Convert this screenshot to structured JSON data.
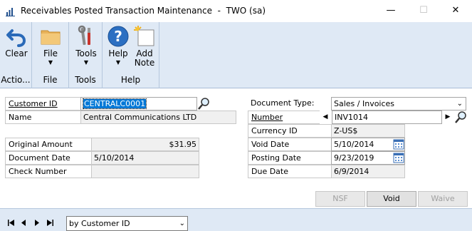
{
  "window": {
    "title": "Receivables Posted Transaction Maintenance  -  TWO (sa)",
    "minimize_glyph": "—",
    "maximize_glyph": "☐",
    "close_glyph": "✕"
  },
  "ribbon": {
    "groups": [
      {
        "label": "Actio...",
        "buttons": [
          {
            "label": "Clear",
            "icon": "undo-icon"
          }
        ]
      },
      {
        "label": "File",
        "buttons": [
          {
            "label": "File",
            "icon": "folder-icon",
            "dropdown": true
          }
        ]
      },
      {
        "label": "Tools",
        "buttons": [
          {
            "label": "Tools",
            "icon": "tools-icon",
            "dropdown": true
          }
        ]
      },
      {
        "label": "Help",
        "buttons": [
          {
            "label": "Help",
            "icon": "help-icon",
            "dropdown": true
          },
          {
            "label": "Add",
            "label2": "Note",
            "icon": "add-note-icon"
          }
        ]
      }
    ],
    "dropdown_glyph": "▼"
  },
  "form": {
    "customer_id": {
      "label": "Customer ID",
      "value": "CENTRALC0001"
    },
    "name": {
      "label": "Name",
      "value": "Central Communications LTD"
    },
    "original_amount": {
      "label": "Original Amount",
      "value": "$31.95"
    },
    "document_date": {
      "label": "Document Date",
      "value": "5/10/2014"
    },
    "check_number": {
      "label": "Check Number",
      "value": ""
    },
    "document_type": {
      "label": "Document Type:",
      "value": "Sales / Invoices"
    },
    "number": {
      "label": "Number",
      "value": "INV1014"
    },
    "currency_id": {
      "label": "Currency ID",
      "value": "Z-US$"
    },
    "void_date": {
      "label": "Void Date",
      "value": "5/10/2014"
    },
    "posting_date": {
      "label": "Posting Date",
      "value": "9/23/2019"
    },
    "due_date": {
      "label": "Due Date",
      "value": "6/9/2014"
    }
  },
  "buttons": {
    "nsf": "NSF",
    "void": "Void",
    "waive": "Waive"
  },
  "statusbar": {
    "sort_by": "by Customer ID",
    "nav": {
      "first": "|◀",
      "prev": "◀",
      "next": "▶",
      "last": "▶|"
    }
  }
}
